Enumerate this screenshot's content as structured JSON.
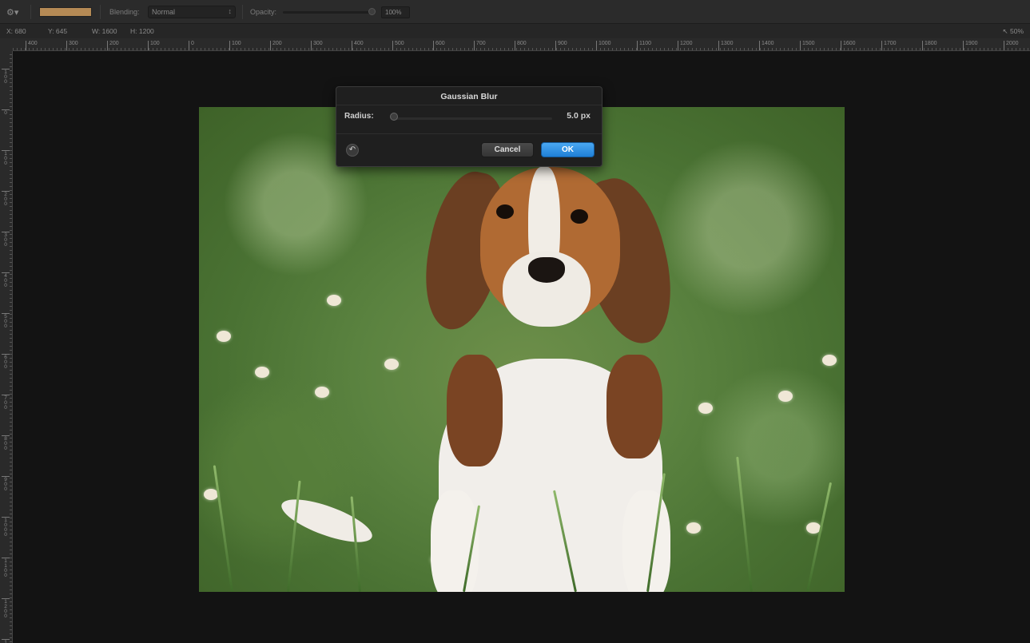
{
  "toolbar": {
    "gear_icon": "gear-icon",
    "color_swatch": "#b58a55",
    "blending_label": "Blending:",
    "blending_value": "Normal",
    "opacity_label": "Opacity:",
    "opacity_value": "100%",
    "opacity_level": 1.0
  },
  "infobar": {
    "x": "X: 680",
    "y": "Y: 645",
    "w": "W: 1600",
    "h": "H: 1200",
    "zoom": "50%"
  },
  "ruler": {
    "h_ticks": [
      "400",
      "300",
      "200",
      "100",
      "0",
      "100",
      "200",
      "300",
      "400",
      "500",
      "600",
      "700",
      "800",
      "900",
      "1000",
      "1100",
      "1200",
      "1300",
      "1400",
      "1500",
      "1600",
      "1700",
      "1800",
      "1900",
      "2000"
    ],
    "v_ticks": [
      "1\n0\n0",
      "0",
      "1\n0\n0",
      "2\n0\n0",
      "3\n0\n0",
      "4\n0\n0",
      "5\n0\n0",
      "6\n0\n0",
      "7\n0\n0",
      "8\n0\n0",
      "9\n0\n0",
      "1\n0\n0\n0",
      "1\n1\n0\n0",
      "1\n2\n0\n0",
      "1\n3\n0\n0"
    ]
  },
  "dialog": {
    "title": "Gaussian Blur",
    "radius_label": "Radius:",
    "radius_value": "5.0 px",
    "cancel_label": "Cancel",
    "ok_label": "OK"
  },
  "colors": {
    "accent": "#2a8de6",
    "background": "#131313"
  }
}
